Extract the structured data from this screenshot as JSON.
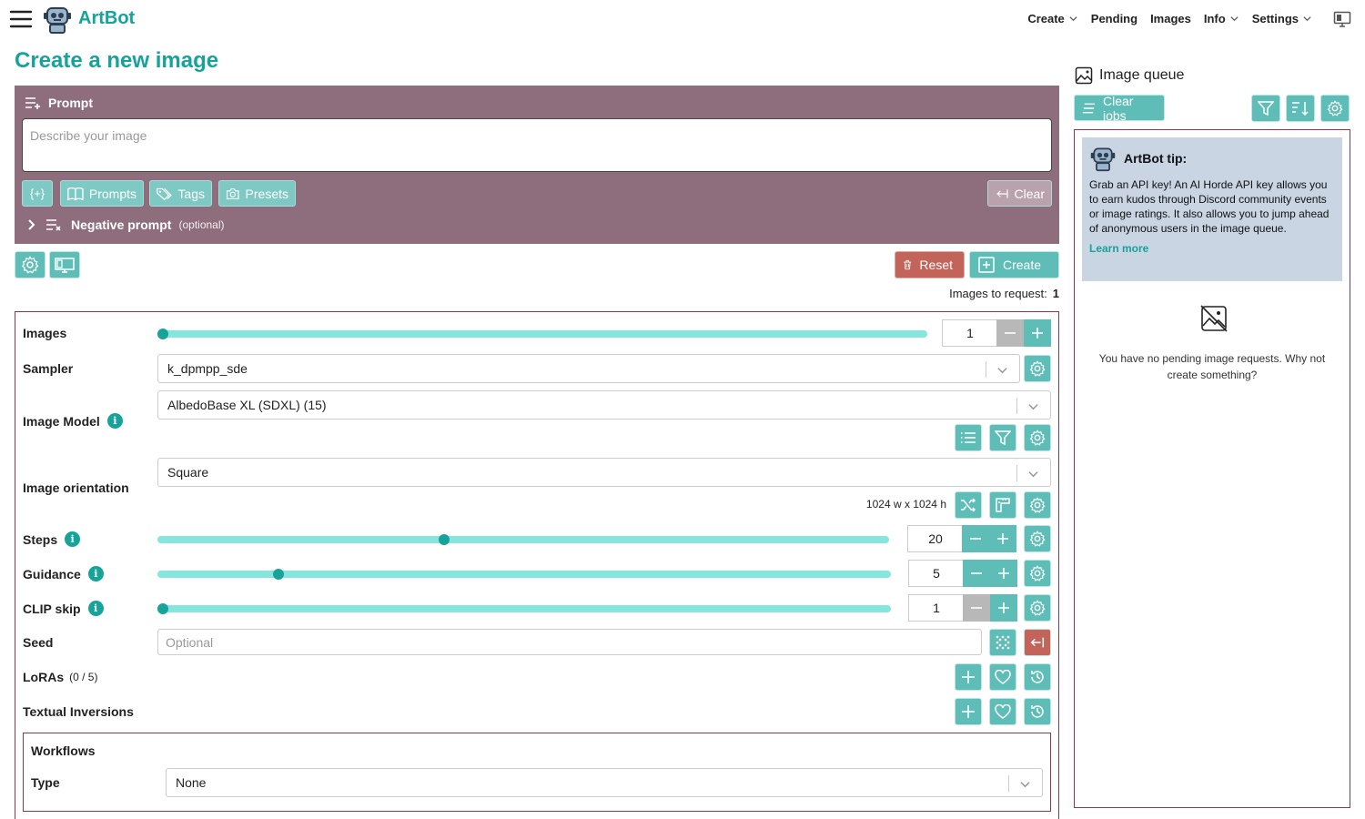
{
  "app": {
    "name": "ArtBot"
  },
  "nav": {
    "create": "Create",
    "pending": "Pending",
    "images": "Images",
    "info": "Info",
    "settings": "Settings"
  },
  "page": {
    "title": "Create a new image"
  },
  "prompt": {
    "label": "Prompt",
    "placeholder": "Describe your image",
    "value": "",
    "buttons": {
      "dynamic": "{+}",
      "prompts": "Prompts",
      "tags": "Tags",
      "presets": "Presets",
      "clear": "Clear"
    },
    "negative": {
      "label": "Negative prompt",
      "hint": "(optional)"
    }
  },
  "actions": {
    "reset": "Reset",
    "create": "Create",
    "images_to_request_label": "Images to request:",
    "images_to_request_value": "1"
  },
  "settings": {
    "images": {
      "label": "Images",
      "value": "1",
      "fraction": 0.0
    },
    "sampler": {
      "label": "Sampler",
      "value": "k_dpmpp_sde"
    },
    "model": {
      "label": "Image Model",
      "value": "AlbedoBase XL (SDXL) (15)"
    },
    "orientation": {
      "label": "Image orientation",
      "value": "Square",
      "dims": "1024 w x 1024 h"
    },
    "steps": {
      "label": "Steps",
      "value": "20",
      "fraction": 0.39
    },
    "guidance": {
      "label": "Guidance",
      "value": "5",
      "fraction": 0.16
    },
    "clip_skip": {
      "label": "CLIP skip",
      "value": "1",
      "fraction": 0.0
    },
    "seed": {
      "label": "Seed",
      "placeholder": "Optional"
    },
    "loras": {
      "label": "LoRAs",
      "count": "(0 / 5)"
    },
    "textual_inversions": {
      "label": "Textual Inversions"
    },
    "workflows": {
      "title": "Workflows",
      "type_label": "Type",
      "type_value": "None"
    }
  },
  "queue": {
    "title": "Image queue",
    "clear_jobs": "Clear jobs",
    "tip": {
      "title": "ArtBot tip:",
      "body": "Grab an API key! An AI Horde API key allows you to earn kudos through Discord community events or image ratings. It also allows you to jump ahead of anonymous users in the image queue.",
      "link": "Learn more"
    },
    "empty": "You have no pending image requests. Why not create something?"
  },
  "colors": {
    "accent": "#15a39a",
    "button": "#5fbdb7",
    "prompt_panel": "#8e6e7c",
    "danger": "#c3645a",
    "border": "#8b3a4e",
    "tip_bg": "#c9d5e3"
  }
}
